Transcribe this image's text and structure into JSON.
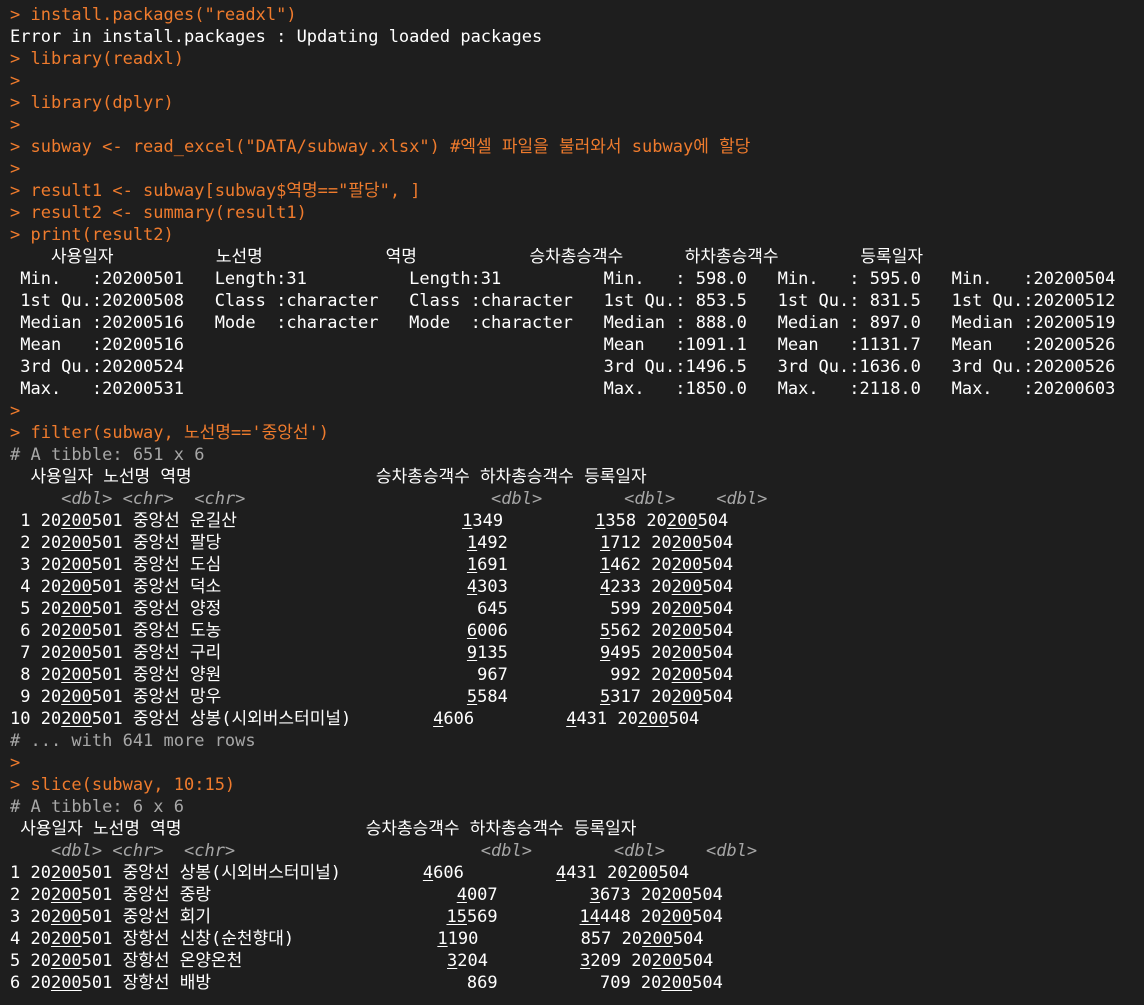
{
  "console": {
    "prompt": ">",
    "lines": [
      {
        "kind": "cmd",
        "text": "> install.packages(\"readxl\")"
      },
      {
        "kind": "out",
        "text": "Error in install.packages : Updating loaded packages"
      },
      {
        "kind": "cmd",
        "text": "> library(readxl)"
      },
      {
        "kind": "cmd",
        "text": ">"
      },
      {
        "kind": "cmd",
        "text": "> library(dplyr)"
      },
      {
        "kind": "cmd",
        "text": ">"
      },
      {
        "kind": "cmd",
        "text": "> subway <- read_excel(\"DATA/subway.xlsx\") #엑셀 파일을 불러와서 subway에 할당"
      },
      {
        "kind": "cmd",
        "text": ">"
      },
      {
        "kind": "cmd",
        "text": "> result1 <- subway[subway$역명==\"팔당\", ]"
      },
      {
        "kind": "cmd",
        "text": "> result2 <- summary(result1)"
      },
      {
        "kind": "cmd",
        "text": "> print(result2)"
      },
      {
        "kind": "out",
        "text": "    사용일자          노선명            역명           승차총승객수      하차총승객수        등록일자"
      },
      {
        "kind": "out",
        "text": " Min.   :20200501   Length:31          Length:31          Min.   : 598.0   Min.   : 595.0   Min.   :20200504"
      },
      {
        "kind": "out",
        "text": " 1st Qu.:20200508   Class :character   Class :character   1st Qu.: 853.5   1st Qu.: 831.5   1st Qu.:20200512"
      },
      {
        "kind": "out",
        "text": " Median :20200516   Mode  :character   Mode  :character   Median : 888.0   Median : 897.0   Median :20200519"
      },
      {
        "kind": "out",
        "text": " Mean   :20200516                                         Mean   :1091.1   Mean   :1131.7   Mean   :20200526"
      },
      {
        "kind": "out",
        "text": " 3rd Qu.:20200524                                         3rd Qu.:1496.5   3rd Qu.:1636.0   3rd Qu.:20200526"
      },
      {
        "kind": "out",
        "text": " Max.   :20200531                                         Max.   :1850.0   Max.   :2118.0   Max.   :20200603"
      },
      {
        "kind": "cmd",
        "text": ">"
      },
      {
        "kind": "cmd",
        "text": "> filter(subway, 노선명=='중앙선')"
      },
      {
        "kind": "comment",
        "text": "# A tibble: 651 x 6"
      },
      {
        "kind": "out",
        "text": "  사용일자 노선명 역명                  승차총승객수 하차총승객수 등록일자"
      },
      {
        "kind": "type",
        "text": "     <dbl> <chr>  <chr>                        <dbl>        <dbl>    <dbl>"
      },
      {
        "kind": "row",
        "text": " 1 20200501 중앙선 운길산                      1349         1358 20200504"
      },
      {
        "kind": "row",
        "text": " 2 20200501 중앙선 팔당                        1492         1712 20200504"
      },
      {
        "kind": "row",
        "text": " 3 20200501 중앙선 도심                        1691         1462 20200504"
      },
      {
        "kind": "row",
        "text": " 4 20200501 중앙선 덕소                        4303         4233 20200504"
      },
      {
        "kind": "row",
        "text": " 5 20200501 중앙선 양정                         645          599 20200504"
      },
      {
        "kind": "row",
        "text": " 6 20200501 중앙선 도농                        6006         5562 20200504"
      },
      {
        "kind": "row",
        "text": " 7 20200501 중앙선 구리                        9135         9495 20200504"
      },
      {
        "kind": "row",
        "text": " 8 20200501 중앙선 양원                         967          992 20200504"
      },
      {
        "kind": "row",
        "text": " 9 20200501 중앙선 망우                        5584         5317 20200504"
      },
      {
        "kind": "row",
        "text": "10 20200501 중앙선 상봉(시외버스터미널)        4606         4431 20200504"
      },
      {
        "kind": "comment",
        "text": "# ... with 641 more rows"
      },
      {
        "kind": "cmd",
        "text": ">"
      },
      {
        "kind": "cmd",
        "text": "> slice(subway, 10:15)"
      },
      {
        "kind": "comment",
        "text": "# A tibble: 6 x 6"
      },
      {
        "kind": "out",
        "text": " 사용일자 노선명 역명                  승차총승객수 하차총승객수 등록일자"
      },
      {
        "kind": "type",
        "text": "    <dbl> <chr>  <chr>                        <dbl>        <dbl>    <dbl>"
      },
      {
        "kind": "row",
        "text": "1 20200501 중앙선 상봉(시외버스터미널)        4606         4431 20200504"
      },
      {
        "kind": "row",
        "text": "2 20200501 중앙선 중랑                        4007         3673 20200504"
      },
      {
        "kind": "row",
        "text": "3 20200501 중앙선 회기                       15569        14448 20200504"
      },
      {
        "kind": "row",
        "text": "4 20200501 장항선 신창(순천향대)              1190          857 20200504"
      },
      {
        "kind": "row",
        "text": "5 20200501 장항선 온양온천                    3204         3209 20200504"
      },
      {
        "kind": "row",
        "text": "6 20200501 장항선 배방                         869          709 20200504"
      }
    ]
  }
}
